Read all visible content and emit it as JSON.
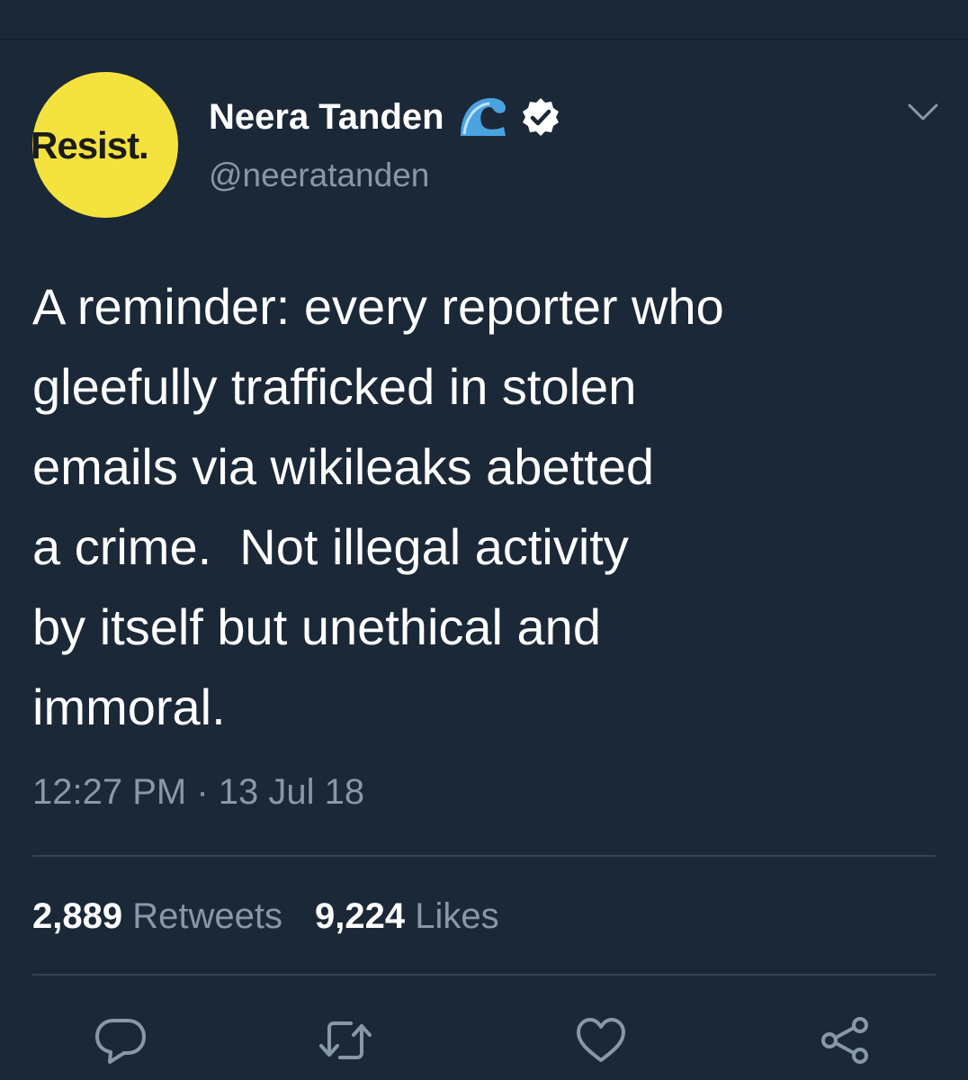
{
  "author": {
    "avatar_text": "Resist.",
    "display_name": "Neera Tanden",
    "handle": "@neeratanden",
    "name_emoji": "wave-emoji",
    "verified_icon": "verified-badge-icon"
  },
  "tweet": {
    "text": "A reminder: every reporter who\ngleefully trafficked in stolen\nemails via wikileaks abetted\na crime.  Not illegal activity\nby itself but unethical and\nimmoral.",
    "timestamp": "12:27 PM · 13 Jul 18"
  },
  "stats": {
    "retweets_count": "2,889",
    "retweets_label": "Retweets",
    "likes_count": "9,224",
    "likes_label": "Likes"
  },
  "actions": [
    "reply-icon",
    "retweet-icon",
    "like-icon",
    "share-icon"
  ],
  "colors": {
    "background": "#1b2837",
    "secondary_text": "#8899a6",
    "divider": "#38444d",
    "avatar_yellow": "#f4e33f",
    "verified_blue": "#1da1f2"
  }
}
